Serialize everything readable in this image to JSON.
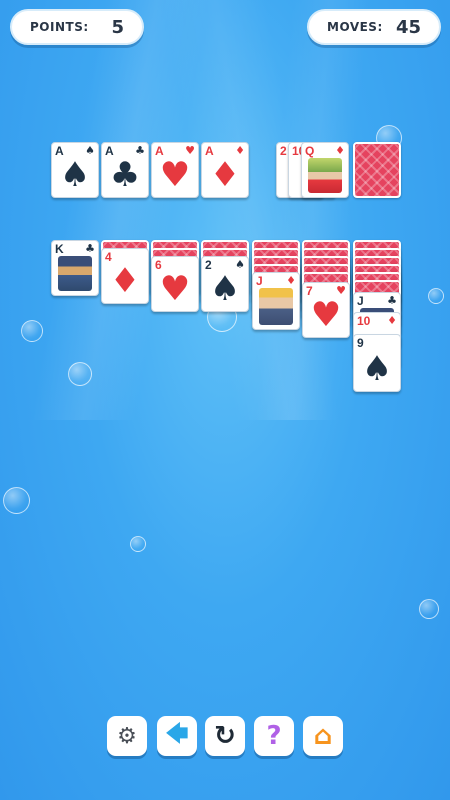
{
  "hud": {
    "points_label": "POINTS:",
    "points_value": "5",
    "moves_label": "MOVES:",
    "moves_value": "45"
  },
  "foundations": [
    {
      "rank": "A",
      "suit": "♠",
      "color": "#1f3346"
    },
    {
      "rank": "A",
      "suit": "♣",
      "color": "#1f3346"
    },
    {
      "rank": "A",
      "suit": "♥",
      "color": "#e6393f"
    },
    {
      "rank": "A",
      "suit": "♦",
      "color": "#e6393f"
    }
  ],
  "waste": [
    {
      "rank": "2",
      "suit": "♦"
    },
    {
      "rank": "10",
      "suit": "♦"
    },
    {
      "rank": "Q",
      "suit": "♦"
    }
  ],
  "tableau": [
    {
      "face_up": [
        {
          "rank": "K",
          "suit": "♣"
        }
      ]
    },
    {
      "face_up": [
        {
          "rank": "4",
          "suit": "♦"
        }
      ]
    },
    {
      "face_up": [
        {
          "rank": "6",
          "suit": "♥"
        }
      ]
    },
    {
      "face_up": [
        {
          "rank": "2",
          "suit": "♠"
        }
      ]
    },
    {
      "face_up": [
        {
          "rank": "J",
          "suit": "♦"
        }
      ]
    },
    {
      "face_up": [
        {
          "rank": "7",
          "suit": "♥"
        }
      ]
    },
    {
      "face_up": [
        {
          "rank": "J",
          "suit": "♣"
        },
        {
          "rank": "10",
          "suit": "♦"
        },
        {
          "rank": "9",
          "suit": "♠"
        }
      ]
    }
  ],
  "toolbar": {
    "settings_icon": "⚙",
    "undo_icon": "🡄",
    "restart_icon": "↻",
    "hint_icon": "?",
    "home_icon": "⌂"
  },
  "colors": {
    "background": "#3ea8f2",
    "card_back": "#e5435f",
    "suit_red": "#e6393f",
    "suit_black": "#1f3346",
    "undo_icon": "#2aa7e8",
    "hint_icon": "#b061e6",
    "home_icon": "#f7941e"
  }
}
